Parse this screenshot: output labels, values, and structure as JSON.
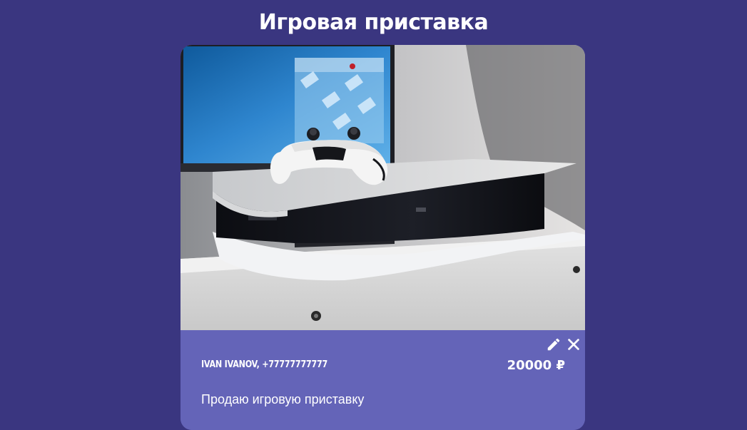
{
  "page": {
    "title": "Игровая приставка"
  },
  "listing": {
    "seller": "IVAN IVANOV, +77777777777",
    "price": "20000 ₽",
    "description": "Продаю игровую приставку",
    "image_subject": "white game console with controller on white cabinet",
    "actions": {
      "edit_icon": "pencil-icon",
      "delete_icon": "close-icon"
    }
  },
  "colors": {
    "background": "#3a3680",
    "card_info": "#6464b8",
    "text": "#ffffff"
  }
}
